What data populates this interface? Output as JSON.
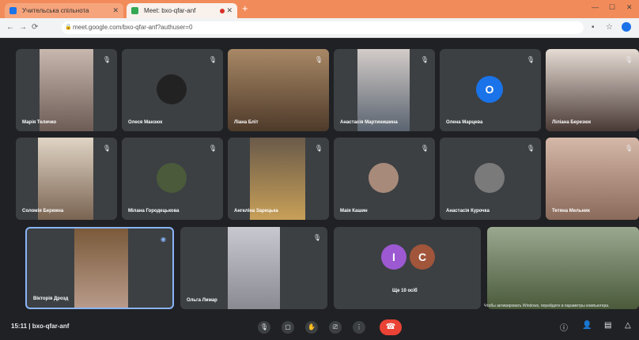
{
  "browser": {
    "tabs": [
      {
        "title": "Учительська спільнота",
        "favicon_color": "#1a73e8"
      },
      {
        "title": "Meet: bxo-qfar-anf",
        "favicon_color": "#34a853"
      }
    ],
    "url": "meet.google.com/bxo-qfar-anf?authuser=0"
  },
  "participants": [
    {
      "name": "Марія Теличко",
      "type": "video",
      "bg": "#6d5c55"
    },
    {
      "name": "Олеся Манзюк",
      "type": "icon",
      "bg": "#3c4043",
      "avatar_color": "#222"
    },
    {
      "name": "Ліана Бліт",
      "type": "video",
      "bg": "#7a5d3f"
    },
    {
      "name": "Анастасія Мартинишина",
      "type": "video",
      "bg": "#5a6470"
    },
    {
      "name": "Олена Марцева",
      "type": "avatar",
      "letter": "O",
      "avatar_color": "#1a73e8"
    },
    {
      "name": "Ліліана Березюк",
      "type": "video",
      "bg": "#4a3a36"
    },
    {
      "name": "Соломія Бережна",
      "type": "video",
      "bg": "#7a6452"
    },
    {
      "name": "Мілана Городецькова",
      "type": "icon",
      "bg": "#3c4043",
      "avatar_color": "#4a5a3a"
    },
    {
      "name": "Ангеліна Зарецька",
      "type": "video",
      "bg": "#9a7a4a"
    },
    {
      "name": "Маія Кашин",
      "type": "icon",
      "bg": "#3c4043",
      "avatar_color": "#a88a7a"
    },
    {
      "name": "Анастасія Курочка",
      "type": "icon",
      "bg": "#3c4043",
      "avatar_color": "#7a7a7a"
    },
    {
      "name": "Тетяна Мельник",
      "type": "video",
      "bg": "#8a6a5a"
    },
    {
      "name": "Вікторія Дрозд",
      "type": "video",
      "bg": "#b89a8a",
      "highlight": true
    },
    {
      "name": "Ольга Лимар",
      "type": "video",
      "bg": "#8a8a92"
    },
    {
      "name": "Ще 10 осіб",
      "type": "group",
      "letters": [
        "I",
        "C"
      ],
      "colors": [
        "#9c59d1",
        "#a1553a"
      ]
    },
    {
      "name": "",
      "type": "video",
      "bg": "#6a7a5a"
    }
  ],
  "bottom": {
    "time": "15:11",
    "meeting_code": "bxo-qfar-anf",
    "caption_text": "Чтобы активировать Windows, перейдите в параметры компьютера."
  }
}
